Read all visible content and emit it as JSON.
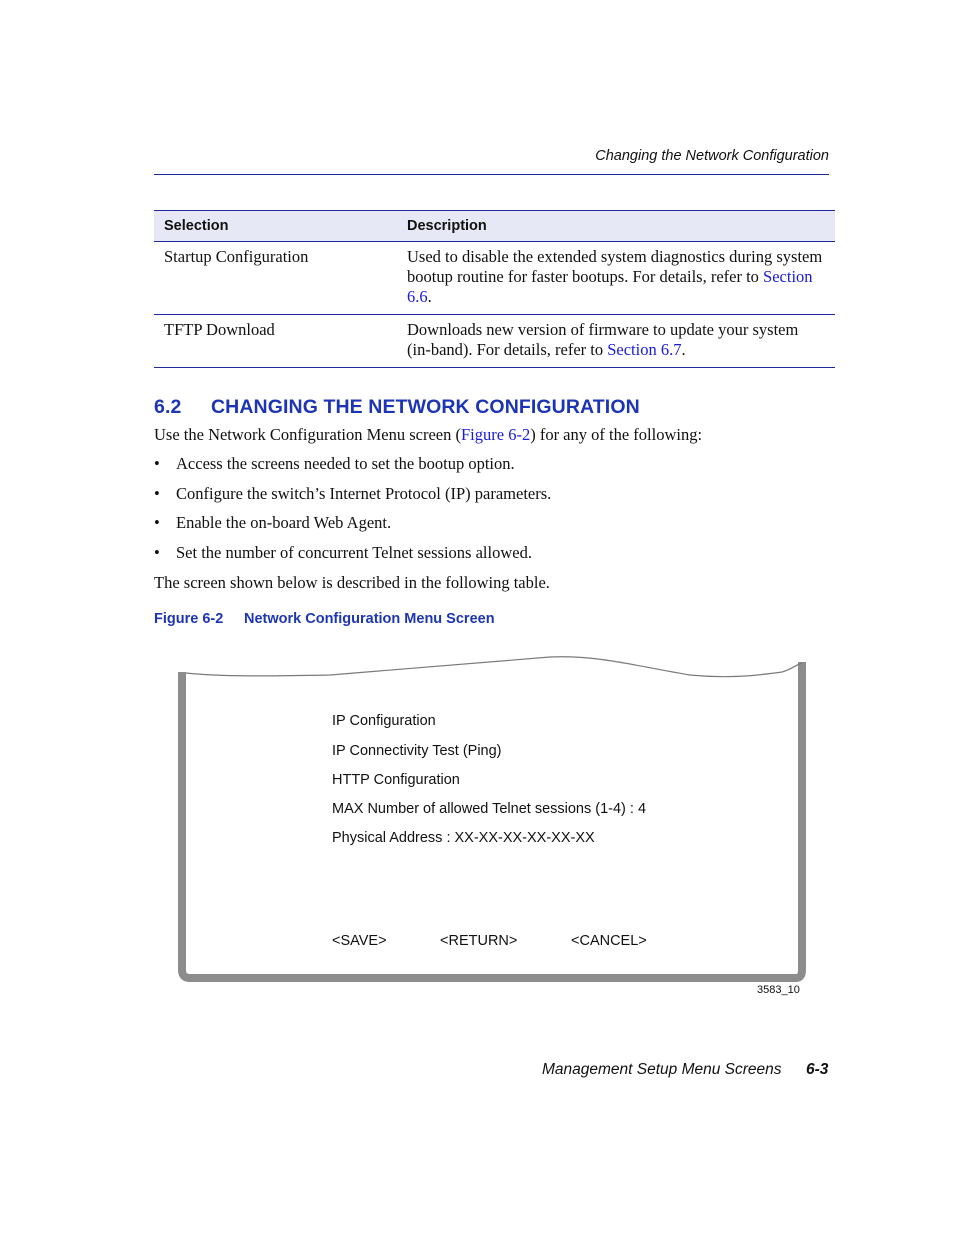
{
  "running_header": "Changing the Network Configuration",
  "table": {
    "headers": [
      "Selection",
      "Description"
    ],
    "rows": [
      {
        "selection": "Startup Configuration",
        "description_text": "Used to disable the extended system diagnostics during system bootup routine for faster bootups. For details, refer to ",
        "link": "Section 6.6",
        "suffix": "."
      },
      {
        "selection": "TFTP Download",
        "description_text": "Downloads new version of firmware to update your system (in-band). For details, refer to ",
        "link": "Section 6.7",
        "suffix": "."
      }
    ]
  },
  "section": {
    "number": "6.2",
    "title": "CHANGING THE NETWORK CONFIGURATION",
    "intro_before": "Use the Network Configuration Menu screen (",
    "intro_link": "Figure 6-2",
    "intro_after": ") for any of the following:",
    "bullet_glyph": "•",
    "bullets": [
      "Access the screens needed to set the bootup option.",
      "Configure the switch’s Internet Protocol (IP) parameters.",
      "Enable the on-board Web Agent.",
      "Set the number of concurrent Telnet sessions allowed."
    ],
    "outro": "The screen shown below is described in the following table."
  },
  "figure": {
    "number": "Figure 6-2",
    "title": "Network Configuration Menu Screen",
    "art_id": "3583_10",
    "menu_items": [
      "IP Configuration",
      "IP Connectivity Test (Ping)",
      "HTTP Configuration",
      "MAX Number of allowed Telnet sessions (1-4) : 4",
      "Physical Address : XX-XX-XX-XX-XX-XX"
    ],
    "actions": {
      "save": "<SAVE>",
      "return": "<RETURN>",
      "cancel": "<CANCEL>"
    }
  },
  "footer": {
    "title": "Management Setup Menu Screens",
    "page": "6-3"
  },
  "colors": {
    "heading_blue": "#1d35b5",
    "link_blue": "#1a1adc",
    "rule_blue": "#1b2a9c",
    "table_header_bg": "#e6e8f5",
    "screen_frame": "#8c8c8c"
  }
}
